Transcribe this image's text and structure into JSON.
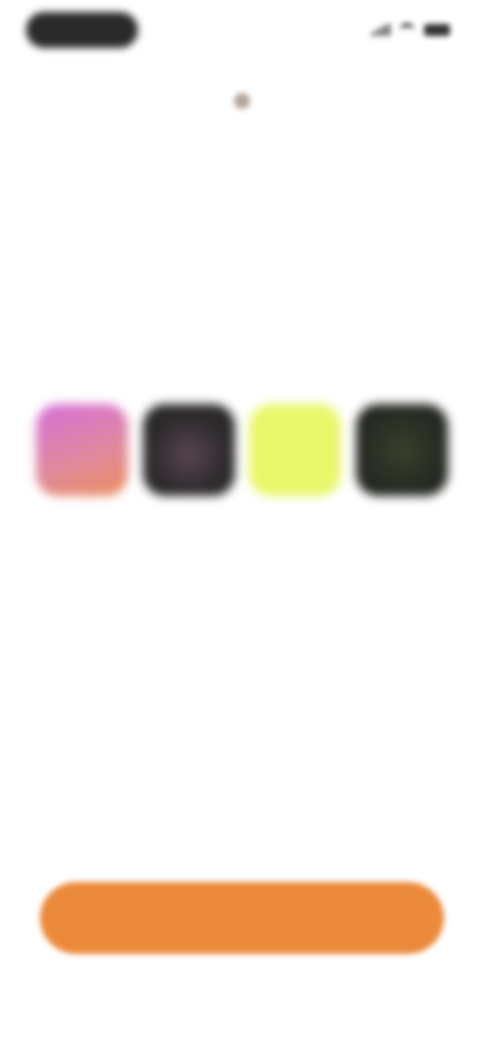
{
  "status_bar": {
    "time": "",
    "icons": [
      "signal-icon",
      "wifi-icon",
      "battery-icon"
    ]
  },
  "brand": {
    "logo_text": ""
  },
  "headline": {
    "line1_start": "",
    "line1_accent": "",
    "line1_end": "",
    "line2": ""
  },
  "swatches": [
    {
      "name": "pink-gradient",
      "colors": [
        "#d66fd8",
        "#ec8d5c"
      ]
    },
    {
      "name": "dark-pattern",
      "colors": [
        "#2e2b2e",
        "#5a4550"
      ]
    },
    {
      "name": "lime",
      "colors": [
        "#e9f76a"
      ]
    },
    {
      "name": "dark-green",
      "colors": [
        "#242821",
        "#3a3f2c"
      ]
    }
  ],
  "cta": {
    "label": "",
    "color": "#ec8a3c"
  },
  "colors": {
    "accent": "#ec8a3c",
    "headline_accent": "#e8b98a",
    "background": "#ffffff"
  }
}
